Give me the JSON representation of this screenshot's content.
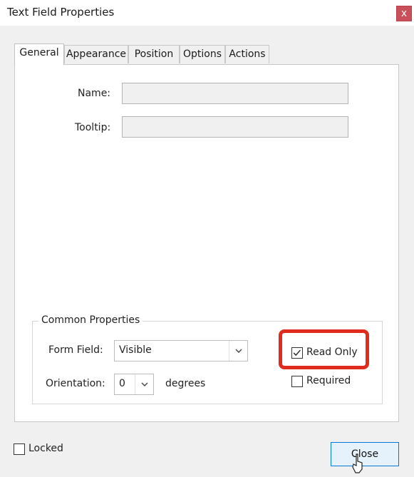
{
  "window": {
    "title": "Text Field Properties",
    "close_glyph": "x"
  },
  "tabs": [
    {
      "label": "General",
      "active": true
    },
    {
      "label": "Appearance",
      "active": false
    },
    {
      "label": "Position",
      "active": false
    },
    {
      "label": "Options",
      "active": false
    },
    {
      "label": "Actions",
      "active": false
    }
  ],
  "general": {
    "name_label": "Name:",
    "name_value": "",
    "tooltip_label": "Tooltip:",
    "tooltip_value": ""
  },
  "common_properties": {
    "title": "Common Properties",
    "form_field_label": "Form Field:",
    "form_field_value": "Visible",
    "orientation_label": "Orientation:",
    "orientation_value": "0",
    "orientation_unit": "degrees",
    "read_only_label": "Read Only",
    "read_only_checked": true,
    "required_label": "Required",
    "required_checked": false
  },
  "footer": {
    "locked_label": "Locked",
    "locked_checked": false,
    "close_button_label": "Close"
  },
  "colors": {
    "highlight": "#e02c1e",
    "button_border": "#0078d7",
    "close_x_bg": "#c94f5a"
  }
}
